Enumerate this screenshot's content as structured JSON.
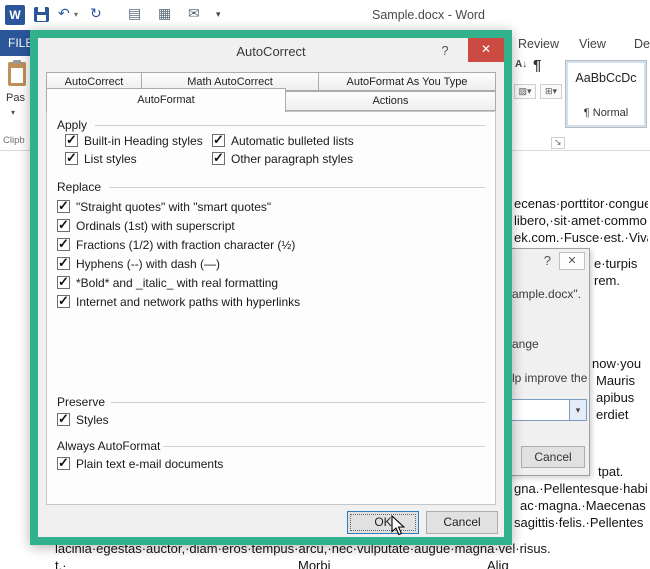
{
  "colors": {
    "highlight_green": "#31b28c",
    "file_tab_blue": "#2b579a",
    "close_red": "#cb4b42"
  },
  "titlebar": {
    "title": "Sample.docx - Word"
  },
  "icons": {
    "word": "W",
    "undo": "↶",
    "redo": "↻",
    "doc": "▤",
    "table": "▦",
    "mail": "✉",
    "dropdown": "▾",
    "pilcrow": "¶",
    "sort": "A↓",
    "shading": "▨▾",
    "borders": "⊞▾",
    "launcher": "↘",
    "help": "?",
    "close": "✕",
    "combo_arrow": "▾"
  },
  "ribbon": {
    "file_tab": "FILE",
    "tabs": [
      "Review",
      "View",
      "De"
    ],
    "paste_label": "Pas",
    "clipboard_group": "Clipb",
    "style_preview": "AaBbCcDc",
    "style_name": "¶ Normal"
  },
  "dialog": {
    "title": "AutoCorrect",
    "tabs_back": [
      "AutoCorrect",
      "Math AutoCorrect",
      "AutoFormat As You Type"
    ],
    "tabs_front": [
      "AutoFormat",
      "Actions"
    ],
    "apply": {
      "label": "Apply",
      "items": [
        "Built-in Heading styles",
        "Automatic bulleted lists",
        "List styles",
        "Other paragraph styles"
      ]
    },
    "replace": {
      "label": "Replace",
      "items": [
        "\"Straight quotes\" with \"smart quotes\"",
        "Ordinals (1st) with superscript",
        "Fractions (1/2) with fraction character (½)",
        "Hyphens (--) with dash (—)",
        "*Bold* and _italic_ with real formatting",
        "Internet and network paths with hyperlinks"
      ]
    },
    "preserve": {
      "label": "Preserve",
      "items": [
        "Styles"
      ]
    },
    "always": {
      "label": "Always AutoFormat",
      "items": [
        "Plain text e-mail documents"
      ]
    },
    "ok": "OK",
    "cancel": "Cancel"
  },
  "bg_dialog": {
    "line1": "ample.docx\".",
    "line2": "ange",
    "line3": "lp improve the",
    "cancel": "Cancel"
  },
  "document": {
    "fragments": [
      "ecenas·porttitor·congue",
      "libero,·sit·amet·commo",
      "ek.com.·Fusce·est.·Viva",
      "e·turpis",
      "rem.",
      "now·you",
      "Mauris",
      "apibus",
      "erdiet",
      "tpat.",
      "gna.·Pellentesque·habit",
      "ac·magna.·Maecenas",
      "sagittis·felis.·Pellentes",
      "lacinia·egestas·auctor,·diam·eros·tempus·arcu,·nec·vulputate·augue·magna·vel·risus.",
      "t.·",
      "Morbi",
      "Aliq"
    ]
  }
}
